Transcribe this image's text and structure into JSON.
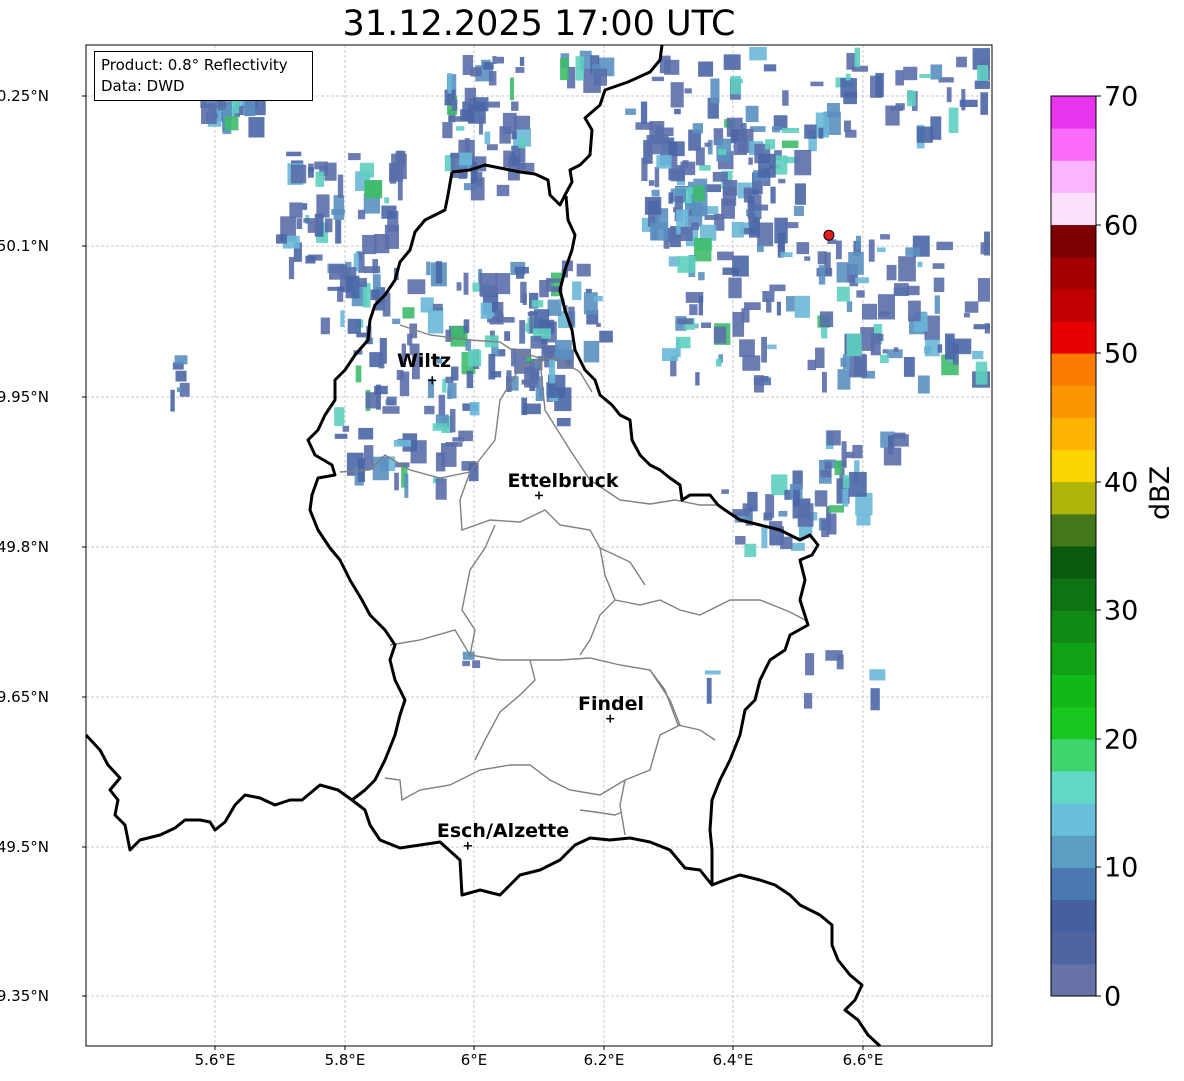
{
  "title": "31.12.2025 17:00 UTC",
  "info": {
    "product": "Product: 0.8° Reflectivity",
    "data": "Data: DWD"
  },
  "latitude_labels": [
    "50.25°N",
    "50.1°N",
    "49.95°N",
    "49.8°N",
    "49.65°N",
    "49.5°N",
    "49.35°N"
  ],
  "longitude_labels": [
    "5.6°E",
    "5.8°E",
    "6°E",
    "6.2°E",
    "6.4°E",
    "6.6°E"
  ],
  "cities": [
    {
      "name": "Wiltz",
      "lon": 5.935,
      "lat": 49.965
    },
    {
      "name": "Ettelbruck",
      "lon": 6.1,
      "lat": 49.85
    },
    {
      "name": "Findel",
      "lon": 6.21,
      "lat": 49.627
    },
    {
      "name": "Esch/Alzette",
      "lon": 5.99,
      "lat": 49.5
    }
  ],
  "radar_site": {
    "lon": 6.548,
    "lat": 50.11,
    "color": "#e81c1c"
  },
  "map_extent": {
    "lon_min": 5.4,
    "lon_max": 6.8,
    "lat_min": 49.3,
    "lat_max": 50.3
  },
  "colorbar": {
    "label": "dBZ",
    "ticks": [
      "0",
      "10",
      "20",
      "30",
      "40",
      "50",
      "60",
      "70"
    ],
    "colors": [
      "#6672a8",
      "#5065a0",
      "#4560a0",
      "#4a78b0",
      "#5a9ec4",
      "#68c0dc",
      "#62d8c8",
      "#3ed46e",
      "#18c81e",
      "#12b818",
      "#10a214",
      "#108a14",
      "#0e7412",
      "#0a5a0e",
      "#44761a",
      "#aeb408",
      "#fcd400",
      "#fcb400",
      "#fc9600",
      "#fc7c00",
      "#e40000",
      "#c00000",
      "#a40000",
      "#7c0000",
      "#fce0fc",
      "#fcb4fc",
      "#fc6cfc",
      "#e834ec"
    ]
  }
}
